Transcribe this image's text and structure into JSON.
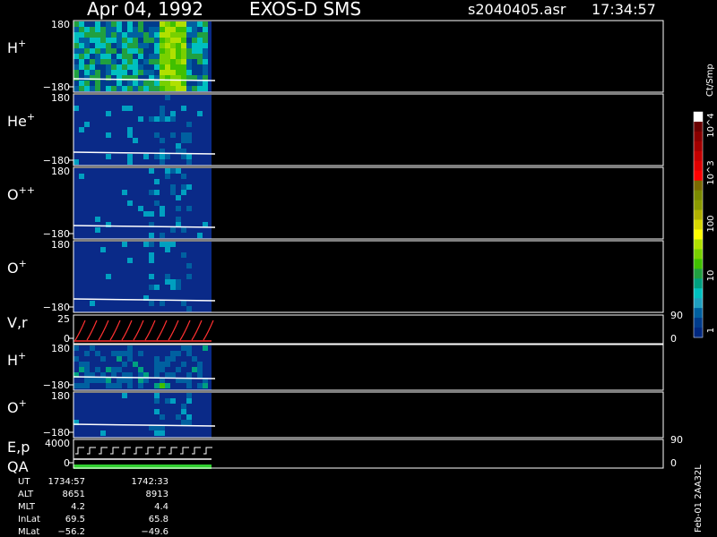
{
  "header": {
    "date": "Apr 04, 1992",
    "instrument": "EXOS-D SMS",
    "file": "s2040405.asr",
    "time": "17:34:57"
  },
  "colorbar": {
    "unit": "Ct/Smp",
    "labels": [
      "10^4",
      "10^3",
      "100",
      "10",
      "1"
    ],
    "colors": [
      "#ffffff",
      "#6a0000",
      "#8a0000",
      "#a30000",
      "#c40000",
      "#e00000",
      "#ff0000",
      "#7a6a00",
      "#7a8a00",
      "#8a9a00",
      "#b0b000",
      "#d8d800",
      "#ffff00",
      "#b0e000",
      "#78d000",
      "#40c000",
      "#20a040",
      "#00a080",
      "#00c0c0",
      "#20a0c0",
      "#0060a0",
      "#003c8c",
      "#002880"
    ]
  },
  "panels": [
    {
      "label_main": "H",
      "label_sup": "+",
      "ymax": "180",
      "ymin": "−180",
      "right": "",
      "right2": ""
    },
    {
      "label_main": "He",
      "label_sup": "+",
      "ymax": "180",
      "ymin": "−180",
      "right": "",
      "right2": ""
    },
    {
      "label_main": "O",
      "label_sup": "++",
      "ymax": "180",
      "ymin": "−180",
      "right": "",
      "right2": ""
    },
    {
      "label_main": "O",
      "label_sup": "+",
      "ymax": "180",
      "ymin": "−180",
      "right": "",
      "right2": ""
    },
    {
      "label_main": "V,r",
      "label_sup": "",
      "ymax": "25",
      "ymin": "0",
      "right": "90",
      "right2": "0"
    },
    {
      "label_main": "H",
      "label_sup": "+",
      "ymax": "180",
      "ymin": "−180",
      "right": "",
      "right2": ""
    },
    {
      "label_main": "O",
      "label_sup": "+",
      "ymax": "180",
      "ymin": "−180",
      "right": "",
      "right2": ""
    },
    {
      "label_main": "E,p",
      "label_sup": "",
      "label_main2": "QA",
      "ymax": "4000",
      "ymin": "0",
      "right": "90",
      "right2": "0"
    }
  ],
  "info": {
    "rows": [
      {
        "name": "UT",
        "v1": "1734:57",
        "v2": "1742:33"
      },
      {
        "name": "ALT",
        "v1": "8651",
        "v2": "8913"
      },
      {
        "name": "MLT",
        "v1": "4.2",
        "v2": "4.4"
      },
      {
        "name": "InLat",
        "v1": "69.5",
        "v2": "65.8"
      },
      {
        "name": "MLat",
        "v1": "−56.2",
        "v2": "−49.6"
      }
    ],
    "footer": "Feb-01 2AA32L"
  },
  "chart_data": {
    "type": "heatmap",
    "title": "Apr 04, 1992   EXOS-D SMS",
    "xlabel": "UT",
    "x_range": [
      "1734:57",
      "1742:33"
    ],
    "panels": [
      {
        "species": "H+",
        "ylim": [
          -180,
          180
        ]
      },
      {
        "species": "He+",
        "ylim": [
          -180,
          180
        ]
      },
      {
        "species": "O++",
        "ylim": [
          -180,
          180
        ]
      },
      {
        "species": "O+",
        "ylim": [
          -180,
          180
        ]
      },
      {
        "species": "V,r",
        "ylim": [
          0,
          25
        ],
        "right_ylim": [
          0,
          90
        ]
      },
      {
        "species": "H+",
        "ylim": [
          -180,
          180
        ]
      },
      {
        "species": "O+",
        "ylim": [
          -180,
          180
        ]
      },
      {
        "species": "E,p / QA",
        "ylim": [
          0,
          4000
        ],
        "right_ylim": [
          0,
          90
        ]
      }
    ],
    "colorbar": {
      "label": "Ct/Smp",
      "scale": "log",
      "range": [
        1,
        10000
      ]
    }
  }
}
